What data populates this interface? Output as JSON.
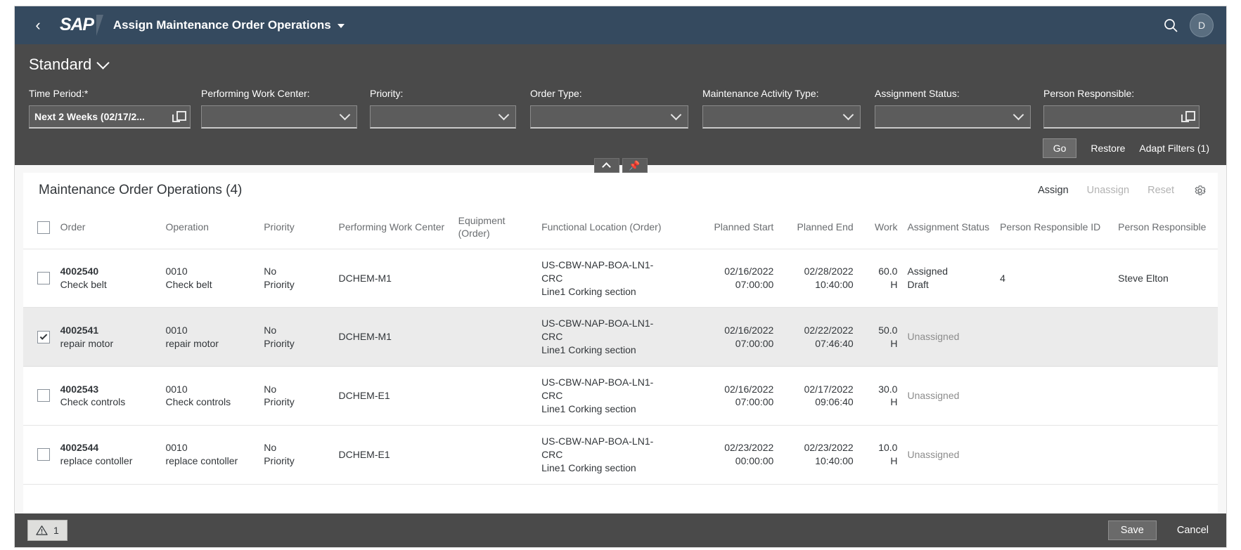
{
  "shell": {
    "back_icon": "back-chevron-icon",
    "logo": "SAP",
    "title": "Assign Maintenance Order Operations",
    "search_icon": "search-icon",
    "avatar_initial": "D"
  },
  "filterbar": {
    "variant": "Standard",
    "fields": [
      {
        "label": "Time Period:",
        "required": true,
        "value": "Next 2 Weeks (02/17/2...",
        "placeholder": "",
        "control": "value-help"
      },
      {
        "label": "Performing Work Center:",
        "required": false,
        "value": "",
        "placeholder": "",
        "control": "dropdown"
      },
      {
        "label": "Priority:",
        "required": false,
        "value": "",
        "placeholder": "",
        "control": "dropdown"
      },
      {
        "label": "Order Type:",
        "required": false,
        "value": "",
        "placeholder": "",
        "control": "dropdown"
      },
      {
        "label": "Maintenance Activity Type:",
        "required": false,
        "value": "",
        "placeholder": "",
        "control": "dropdown"
      },
      {
        "label": "Assignment Status:",
        "required": false,
        "value": "",
        "placeholder": "",
        "control": "dropdown"
      },
      {
        "label": "Person Responsible:",
        "required": false,
        "value": "",
        "placeholder": "",
        "control": "value-help"
      }
    ],
    "go_label": "Go",
    "restore_label": "Restore",
    "adapt_filters_label": "Adapt Filters (1)",
    "collapse_icon": "chevron-up-icon",
    "pin_icon": "pin-icon"
  },
  "table": {
    "title": "Maintenance Order Operations (4)",
    "assign_label": "Assign",
    "unassign_label": "Unassign",
    "reset_label": "Reset",
    "settings_icon": "gear-icon",
    "columns": [
      "Order",
      "Operation",
      "Priority",
      "Performing Work Center",
      "Equipment (Order)",
      "Functional Location (Order)",
      "Planned Start",
      "Planned End",
      "Work",
      "Assignment Status",
      "Person Responsible ID",
      "Person Responsible"
    ],
    "rows": [
      {
        "selected": false,
        "order_id": "4002540",
        "order_desc": "Check belt",
        "operation_id": "0010",
        "operation_desc": "Check belt",
        "priority": "No Priority",
        "work_center": "DCHEM-M1",
        "equipment": "",
        "floc_line1": "US-CBW-NAP-BOA-LN1-",
        "floc_line2": "CRC",
        "floc_line3": "Line1 Corking section",
        "planned_start_date": "02/16/2022",
        "planned_start_time": "07:00:00",
        "planned_end_date": "02/28/2022",
        "planned_end_time": "10:40:00",
        "work_value": "60.0",
        "work_unit": "H",
        "assignment_status_l1": "Assigned",
        "assignment_status_l2": "Draft",
        "assignment_muted": false,
        "person_id": "4",
        "person_name": "Steve Elton"
      },
      {
        "selected": true,
        "order_id": "4002541",
        "order_desc": "repair motor",
        "operation_id": "0010",
        "operation_desc": "repair motor",
        "priority": "No Priority",
        "work_center": "DCHEM-M1",
        "equipment": "",
        "floc_line1": "US-CBW-NAP-BOA-LN1-",
        "floc_line2": "CRC",
        "floc_line3": "Line1 Corking section",
        "planned_start_date": "02/16/2022",
        "planned_start_time": "07:00:00",
        "planned_end_date": "02/22/2022",
        "planned_end_time": "07:46:40",
        "work_value": "50.0",
        "work_unit": "H",
        "assignment_status_l1": "Unassigned",
        "assignment_status_l2": "",
        "assignment_muted": true,
        "person_id": "",
        "person_name": ""
      },
      {
        "selected": false,
        "order_id": "4002543",
        "order_desc": "Check controls",
        "operation_id": "0010",
        "operation_desc": "Check controls",
        "priority": "No Priority",
        "work_center": "DCHEM-E1",
        "equipment": "",
        "floc_line1": "US-CBW-NAP-BOA-LN1-",
        "floc_line2": "CRC",
        "floc_line3": "Line1 Corking section",
        "planned_start_date": "02/16/2022",
        "planned_start_time": "07:00:00",
        "planned_end_date": "02/17/2022",
        "planned_end_time": "09:06:40",
        "work_value": "30.0",
        "work_unit": "H",
        "assignment_status_l1": "Unassigned",
        "assignment_status_l2": "",
        "assignment_muted": true,
        "person_id": "",
        "person_name": ""
      },
      {
        "selected": false,
        "order_id": "4002544",
        "order_desc": "replace contoller",
        "operation_id": "0010",
        "operation_desc": "replace contoller",
        "priority": "No Priority",
        "work_center": "DCHEM-E1",
        "equipment": "",
        "floc_line1": "US-CBW-NAP-BOA-LN1-",
        "floc_line2": "CRC",
        "floc_line3": "Line1 Corking section",
        "planned_start_date": "02/23/2022",
        "planned_start_time": "00:00:00",
        "planned_end_date": "02/23/2022",
        "planned_end_time": "10:40:00",
        "work_value": "10.0",
        "work_unit": "H",
        "assignment_status_l1": "Unassigned",
        "assignment_status_l2": "",
        "assignment_muted": true,
        "person_id": "",
        "person_name": ""
      }
    ]
  },
  "footer": {
    "message_icon": "warning-triangle-icon",
    "message_count": "1",
    "save_label": "Save",
    "cancel_label": "Cancel"
  },
  "colors": {
    "shellbar": "#354a5f",
    "filterbar": "#4a4a4a",
    "selected_row": "#ebebeb",
    "muted_text": "#8c8c8c"
  }
}
